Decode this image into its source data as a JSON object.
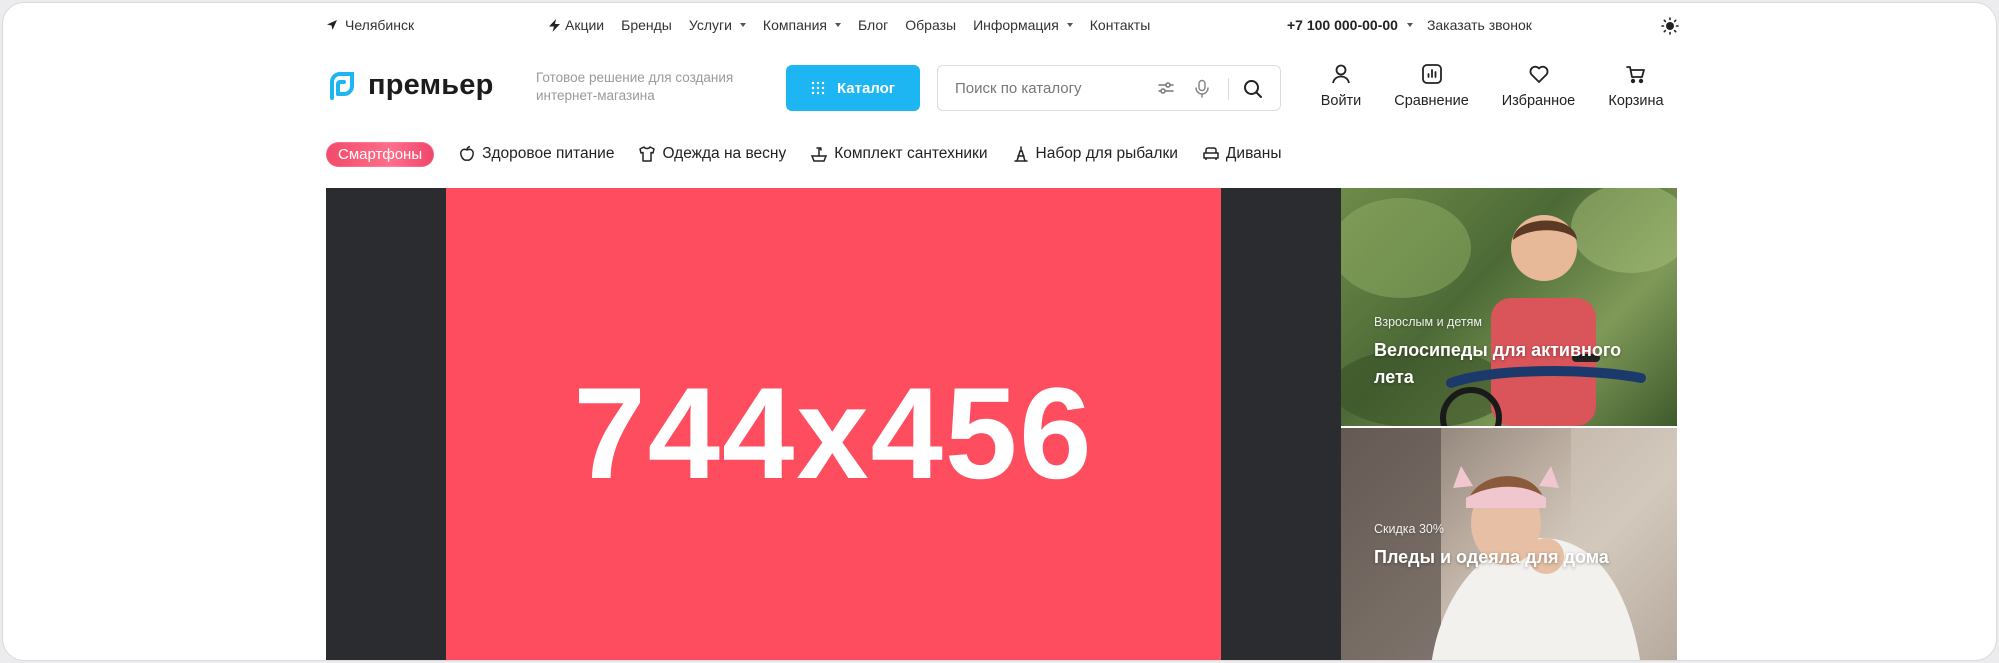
{
  "topbar": {
    "city": "Челябинск",
    "nav": [
      {
        "label": "Акции",
        "icon": "lightning-icon",
        "dropdown": false
      },
      {
        "label": "Бренды",
        "dropdown": false
      },
      {
        "label": "Услуги",
        "dropdown": true
      },
      {
        "label": "Компания",
        "dropdown": true
      },
      {
        "label": "Блог",
        "dropdown": false
      },
      {
        "label": "Образы",
        "dropdown": false
      },
      {
        "label": "Информация",
        "dropdown": true
      },
      {
        "label": "Контакты",
        "dropdown": false
      }
    ],
    "phone": "+7 100 000-00-00",
    "callback": "Заказать звонок"
  },
  "header": {
    "logo_text": "премьер",
    "tagline": "Готовое решение для создания интернет-магазина",
    "catalog_label": "Каталог",
    "search_placeholder": "Поиск по каталогу",
    "actions": [
      {
        "label": "Войти",
        "icon": "user-icon"
      },
      {
        "label": "Сравнение",
        "icon": "compare-chart-icon"
      },
      {
        "label": "Избранное",
        "icon": "heart-icon"
      },
      {
        "label": "Корзина",
        "icon": "cart-icon"
      }
    ]
  },
  "categories": {
    "highlight": "Смартфоны",
    "items": [
      {
        "label": "Здоровое питание",
        "icon": "apple-icon"
      },
      {
        "label": "Одежда на весну",
        "icon": "shirt-icon"
      },
      {
        "label": "Комплект сантехники",
        "icon": "faucet-icon"
      },
      {
        "label": "Набор для рыбалки",
        "icon": "fishing-icon"
      },
      {
        "label": "Диваны",
        "icon": "sofa-icon"
      }
    ]
  },
  "hero": {
    "size_text": "744x456",
    "colors": {
      "background": "#ff4d60",
      "side_bars": "#2b2c30"
    }
  },
  "side_banners": [
    {
      "subtitle": "Взрослым и детям",
      "title": "Велосипеды для активного лета"
    },
    {
      "subtitle": "Скидка 30%",
      "title": "Пледы и одеяла для дома"
    }
  ],
  "colors": {
    "accent": "#1eb6f2",
    "pill": "#f24a6a"
  }
}
